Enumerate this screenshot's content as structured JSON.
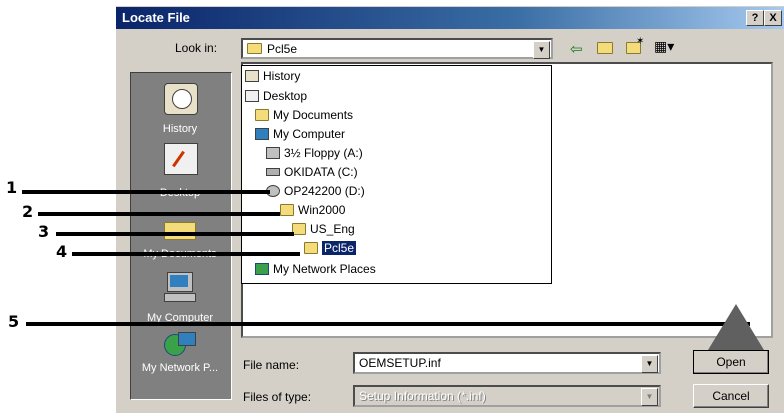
{
  "dialog": {
    "title": "Locate File",
    "help_button": "?",
    "close_button": "X",
    "look_in_label": "Look in:",
    "look_in_value": "Pcl5e",
    "file_name_label": "File name:",
    "file_name_value": "OEMSETUP.inf",
    "files_of_type_label": "Files of type:",
    "files_of_type_value": "Setup Information (*.inf)",
    "open_button": "Open",
    "cancel_button": "Cancel"
  },
  "places_bar": [
    {
      "label": "History",
      "icon": "history-icon"
    },
    {
      "label": "Desktop",
      "icon": "desktop-icon"
    },
    {
      "label": "My Documents",
      "icon": "my-documents-icon"
    },
    {
      "label": "My Computer",
      "icon": "my-computer-icon"
    },
    {
      "label": "My Network P...",
      "icon": "network-places-icon"
    }
  ],
  "look_in_dropdown": [
    {
      "label": "History",
      "icon": "history-icon"
    },
    {
      "label": "Desktop",
      "icon": "desktop-icon"
    },
    {
      "label": "My Documents",
      "icon": "my-documents-icon"
    },
    {
      "label": "My Computer",
      "icon": "my-computer-icon"
    },
    {
      "label": "3½ Floppy (A:)",
      "icon": "floppy-icon"
    },
    {
      "label": "OKIDATA (C:)",
      "icon": "hard-drive-icon"
    },
    {
      "label": "OP242200 (D:)",
      "icon": "cd-drive-icon"
    },
    {
      "label": "Win2000",
      "icon": "folder-icon"
    },
    {
      "label": "US_Eng",
      "icon": "folder-icon"
    },
    {
      "label": "Pcl5e",
      "icon": "open-folder-icon",
      "selected": true
    },
    {
      "label": "My Network Places",
      "icon": "network-places-icon"
    }
  ],
  "callouts": [
    "1",
    "2",
    "3",
    "4",
    "5"
  ],
  "colors": {
    "titlebar": "#0a246a",
    "selection": "#0a246a",
    "dialog_bg": "#d4d0c8"
  }
}
